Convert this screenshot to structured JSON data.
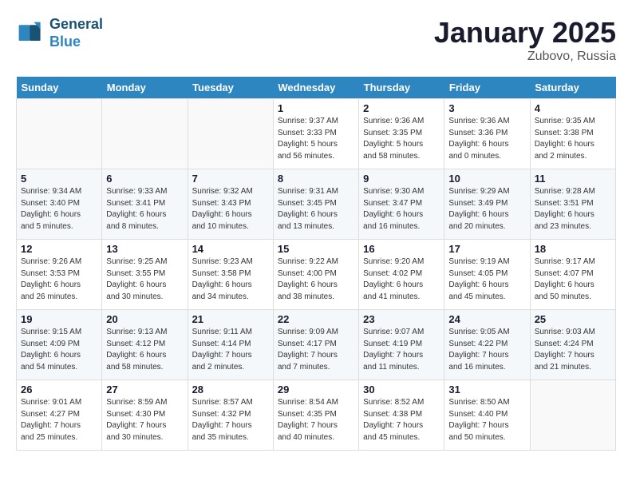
{
  "header": {
    "logo_line1": "General",
    "logo_line2": "Blue",
    "month_title": "January 2025",
    "location": "Zubovo, Russia"
  },
  "days_of_week": [
    "Sunday",
    "Monday",
    "Tuesday",
    "Wednesday",
    "Thursday",
    "Friday",
    "Saturday"
  ],
  "weeks": [
    [
      {
        "day": "",
        "info": ""
      },
      {
        "day": "",
        "info": ""
      },
      {
        "day": "",
        "info": ""
      },
      {
        "day": "1",
        "info": "Sunrise: 9:37 AM\nSunset: 3:33 PM\nDaylight: 5 hours\nand 56 minutes."
      },
      {
        "day": "2",
        "info": "Sunrise: 9:36 AM\nSunset: 3:35 PM\nDaylight: 5 hours\nand 58 minutes."
      },
      {
        "day": "3",
        "info": "Sunrise: 9:36 AM\nSunset: 3:36 PM\nDaylight: 6 hours\nand 0 minutes."
      },
      {
        "day": "4",
        "info": "Sunrise: 9:35 AM\nSunset: 3:38 PM\nDaylight: 6 hours\nand 2 minutes."
      }
    ],
    [
      {
        "day": "5",
        "info": "Sunrise: 9:34 AM\nSunset: 3:40 PM\nDaylight: 6 hours\nand 5 minutes."
      },
      {
        "day": "6",
        "info": "Sunrise: 9:33 AM\nSunset: 3:41 PM\nDaylight: 6 hours\nand 8 minutes."
      },
      {
        "day": "7",
        "info": "Sunrise: 9:32 AM\nSunset: 3:43 PM\nDaylight: 6 hours\nand 10 minutes."
      },
      {
        "day": "8",
        "info": "Sunrise: 9:31 AM\nSunset: 3:45 PM\nDaylight: 6 hours\nand 13 minutes."
      },
      {
        "day": "9",
        "info": "Sunrise: 9:30 AM\nSunset: 3:47 PM\nDaylight: 6 hours\nand 16 minutes."
      },
      {
        "day": "10",
        "info": "Sunrise: 9:29 AM\nSunset: 3:49 PM\nDaylight: 6 hours\nand 20 minutes."
      },
      {
        "day": "11",
        "info": "Sunrise: 9:28 AM\nSunset: 3:51 PM\nDaylight: 6 hours\nand 23 minutes."
      }
    ],
    [
      {
        "day": "12",
        "info": "Sunrise: 9:26 AM\nSunset: 3:53 PM\nDaylight: 6 hours\nand 26 minutes."
      },
      {
        "day": "13",
        "info": "Sunrise: 9:25 AM\nSunset: 3:55 PM\nDaylight: 6 hours\nand 30 minutes."
      },
      {
        "day": "14",
        "info": "Sunrise: 9:23 AM\nSunset: 3:58 PM\nDaylight: 6 hours\nand 34 minutes."
      },
      {
        "day": "15",
        "info": "Sunrise: 9:22 AM\nSunset: 4:00 PM\nDaylight: 6 hours\nand 38 minutes."
      },
      {
        "day": "16",
        "info": "Sunrise: 9:20 AM\nSunset: 4:02 PM\nDaylight: 6 hours\nand 41 minutes."
      },
      {
        "day": "17",
        "info": "Sunrise: 9:19 AM\nSunset: 4:05 PM\nDaylight: 6 hours\nand 45 minutes."
      },
      {
        "day": "18",
        "info": "Sunrise: 9:17 AM\nSunset: 4:07 PM\nDaylight: 6 hours\nand 50 minutes."
      }
    ],
    [
      {
        "day": "19",
        "info": "Sunrise: 9:15 AM\nSunset: 4:09 PM\nDaylight: 6 hours\nand 54 minutes."
      },
      {
        "day": "20",
        "info": "Sunrise: 9:13 AM\nSunset: 4:12 PM\nDaylight: 6 hours\nand 58 minutes."
      },
      {
        "day": "21",
        "info": "Sunrise: 9:11 AM\nSunset: 4:14 PM\nDaylight: 7 hours\nand 2 minutes."
      },
      {
        "day": "22",
        "info": "Sunrise: 9:09 AM\nSunset: 4:17 PM\nDaylight: 7 hours\nand 7 minutes."
      },
      {
        "day": "23",
        "info": "Sunrise: 9:07 AM\nSunset: 4:19 PM\nDaylight: 7 hours\nand 11 minutes."
      },
      {
        "day": "24",
        "info": "Sunrise: 9:05 AM\nSunset: 4:22 PM\nDaylight: 7 hours\nand 16 minutes."
      },
      {
        "day": "25",
        "info": "Sunrise: 9:03 AM\nSunset: 4:24 PM\nDaylight: 7 hours\nand 21 minutes."
      }
    ],
    [
      {
        "day": "26",
        "info": "Sunrise: 9:01 AM\nSunset: 4:27 PM\nDaylight: 7 hours\nand 25 minutes."
      },
      {
        "day": "27",
        "info": "Sunrise: 8:59 AM\nSunset: 4:30 PM\nDaylight: 7 hours\nand 30 minutes."
      },
      {
        "day": "28",
        "info": "Sunrise: 8:57 AM\nSunset: 4:32 PM\nDaylight: 7 hours\nand 35 minutes."
      },
      {
        "day": "29",
        "info": "Sunrise: 8:54 AM\nSunset: 4:35 PM\nDaylight: 7 hours\nand 40 minutes."
      },
      {
        "day": "30",
        "info": "Sunrise: 8:52 AM\nSunset: 4:38 PM\nDaylight: 7 hours\nand 45 minutes."
      },
      {
        "day": "31",
        "info": "Sunrise: 8:50 AM\nSunset: 4:40 PM\nDaylight: 7 hours\nand 50 minutes."
      },
      {
        "day": "",
        "info": ""
      }
    ]
  ]
}
